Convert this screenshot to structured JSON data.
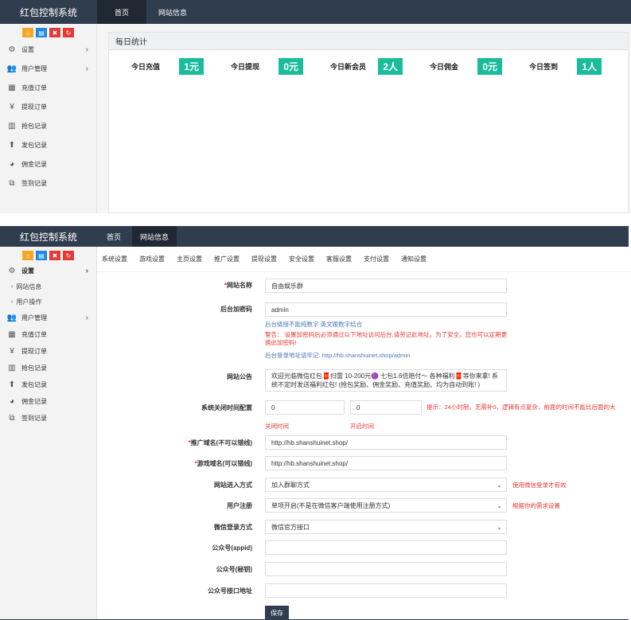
{
  "app_title": "红包控制系统",
  "dashboard": {
    "nav": [
      "首页",
      "网站信息"
    ],
    "quick_icons": [
      "home-icon",
      "document-icon",
      "trash-icon",
      "refresh-icon"
    ],
    "sidebar": [
      {
        "icon": "gears-icon",
        "glyph": "⚙",
        "label": "设置",
        "has_arrow": true
      },
      {
        "icon": "users-icon",
        "glyph": "👥",
        "label": "用户管理",
        "has_arrow": true
      },
      {
        "icon": "area-chart-icon",
        "glyph": "▦",
        "label": "充值订单"
      },
      {
        "icon": "yen-icon",
        "glyph": "¥",
        "label": "提现订单"
      },
      {
        "icon": "bar-chart-icon",
        "glyph": "▥",
        "label": "抢包记录"
      },
      {
        "icon": "upload-icon",
        "glyph": "⬆",
        "label": "发包记录"
      },
      {
        "icon": "pie-chart-icon",
        "glyph": "◕",
        "label": "佣金记录"
      },
      {
        "icon": "sign-in-icon",
        "glyph": "⧉",
        "label": "签到记录"
      }
    ],
    "card_title": "每日统计",
    "stats": [
      {
        "label": "今日充值",
        "value": "1元"
      },
      {
        "label": "今日提现",
        "value": "0元"
      },
      {
        "label": "今日新会员",
        "value": "2人"
      },
      {
        "label": "今日佣金",
        "value": "0元"
      },
      {
        "label": "今日签到",
        "value": "1人"
      }
    ]
  },
  "settings_page": {
    "nav": [
      "首页",
      "网站信息"
    ],
    "sidebar_top": {
      "label": "设置",
      "arrow": "›"
    },
    "sidebar_sub": [
      "网站信息",
      "用户操作"
    ],
    "sidebar_rest": [
      {
        "icon": "users-icon",
        "glyph": "👥",
        "label": "用户管理",
        "has_arrow": true
      },
      {
        "icon": "area-chart-icon",
        "glyph": "▦",
        "label": "充值订单"
      },
      {
        "icon": "yen-icon",
        "glyph": "¥",
        "label": "提现订单"
      },
      {
        "icon": "bar-chart-icon",
        "glyph": "▥",
        "label": "抢包记录"
      },
      {
        "icon": "upload-icon",
        "glyph": "⬆",
        "label": "发包记录"
      },
      {
        "icon": "pie-chart-icon",
        "glyph": "◕",
        "label": "佣金记录"
      },
      {
        "icon": "sign-in-icon",
        "glyph": "⧉",
        "label": "签到记录"
      }
    ],
    "tabs": [
      "系统设置",
      "游戏设置",
      "主页设置",
      "推广设置",
      "提现设置",
      "安全设置",
      "客服设置",
      "支付设置",
      "通知设置"
    ],
    "fields": {
      "site_name": {
        "label": "网站名称",
        "required": true,
        "value": "自由娱乐群"
      },
      "admin_password": {
        "label": "后台加密码",
        "value": "admin",
        "hint": "后台链接不能纯数字 英文跟数字结合",
        "warning": "警告： 设置加密码后必须通过以下地址访问后台,请劳记此地址。为了安全，您也可以定期更换此加密码!",
        "login_hint": "后台登录地址请牢记:  http://hb.shanshuinet.shop/admin"
      },
      "notice": {
        "label": "网站公告",
        "value": "欢迎光临微信红包🧧扫雷  10-200元🟣 七包1.6倍赔付～ 各种福利🧧等你来拿! 系统不定时发送福利红包! (抢包奖励、佣金奖励、充值奖励、均为自动到账! )"
      },
      "close_time": {
        "label": "系统关闭时间配置",
        "close_value": "0",
        "open_value": "0",
        "close_caption": "关闭时间",
        "open_caption": "开启时间",
        "tip": "提示：24小时制，无需补0，逻辑有点复杂，前面的时间不能比后面的大"
      },
      "promo_domain": {
        "label": "推广域名(不可以错线)",
        "required": true,
        "value": "http://hb.shanshuinet.shop/"
      },
      "game_domain": {
        "label": "游戏域名(可以错线)",
        "required": true,
        "value": "http://hb.shanshuinet.shop/"
      },
      "enter_mode": {
        "label": "网站进入方式",
        "value": "加入群聊方式",
        "tip": "使用微信登录才有效"
      },
      "register": {
        "label": "用户注册",
        "value": "单项开启(不是在微信客户端使用注册方式)",
        "tip": "根据你的需求设置"
      },
      "wechat_login": {
        "label": "微信登录方式",
        "value": "微信官方接口"
      },
      "appid": {
        "label": "公众号(appid)",
        "value": ""
      },
      "secret": {
        "label": "公众号(秘钥)",
        "value": ""
      },
      "api_url": {
        "label": "公众号接口地址",
        "value": ""
      }
    },
    "save_label": "保存"
  }
}
